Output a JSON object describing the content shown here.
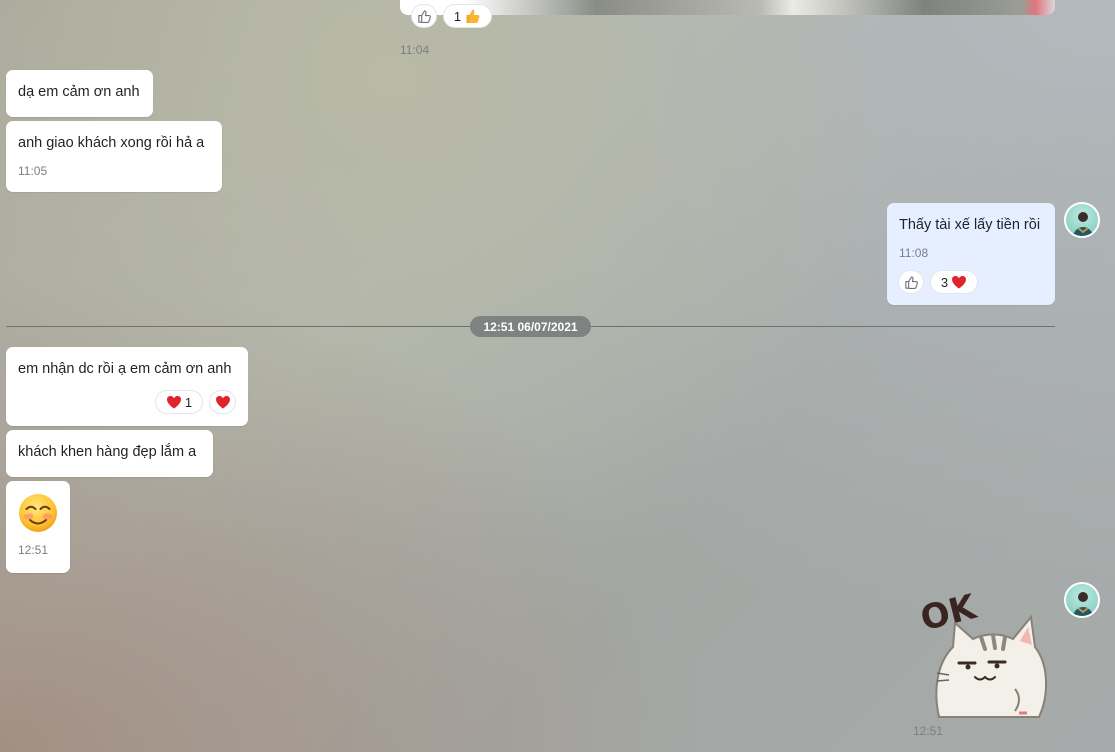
{
  "top_message": {
    "reaction_count": "1",
    "time": "11:04"
  },
  "messages": {
    "m1": {
      "text": "dạ em cảm ơn anh"
    },
    "m2": {
      "text": "anh giao khách xong rồi hả a",
      "time": "11:05"
    },
    "m3": {
      "text": "Thấy tài xế lấy tiền rồi",
      "time": "11:08",
      "reaction_count": "3"
    },
    "m4": {
      "text": "em nhận dc rồi ạ em cảm ơn anh",
      "reaction_count": "1"
    },
    "m5": {
      "text": "khách khen hàng đẹp lắm a"
    },
    "m6": {
      "emoji": "blushing-smile",
      "time": "12:51"
    },
    "m7": {
      "sticker": "ok-cat-sticker",
      "sticker_text": "OK",
      "time": "12:51"
    }
  },
  "date_divider": "12:51 06/07/2021",
  "colors": {
    "my_bubble": "#e5efff",
    "their_bubble": "#ffffff",
    "heart": "#e0242d"
  }
}
